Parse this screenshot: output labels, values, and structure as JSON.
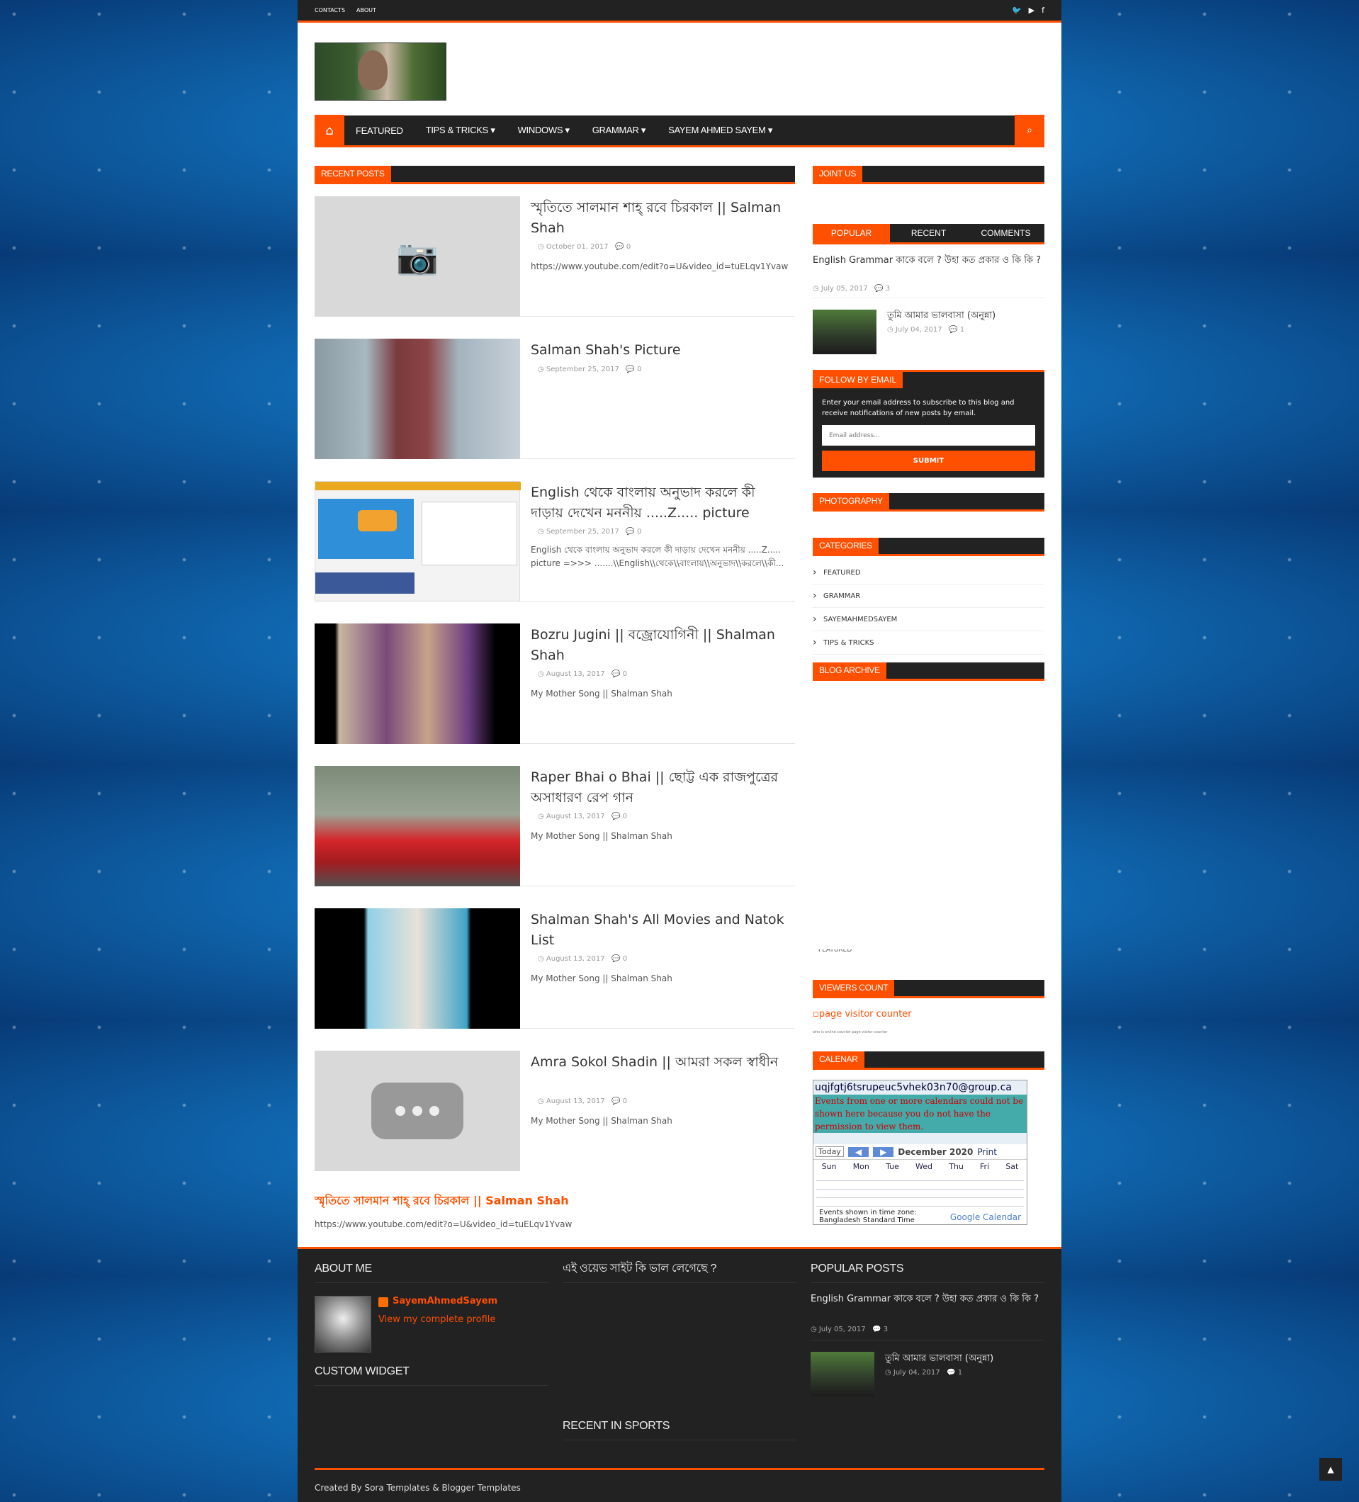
{
  "topbar": {
    "links": [
      "CONTACTS",
      "ABOUT"
    ],
    "social_icons": [
      "twitter-icon",
      "youtube-icon",
      "facebook-icon"
    ]
  },
  "nav": {
    "items": [
      "FEATURED",
      "TIPS & TRICKS",
      "WINDOWS",
      "GRAMMAR",
      "SAYEM AHMED SAYEM"
    ]
  },
  "recent_posts": {
    "heading": "RECENT POSTS",
    "posts": [
      {
        "title": "স্মৃতিতে সালমান শাহ্ রবে চিরকাল || Salman Shah",
        "date": "October 01, 2017",
        "comments": "0",
        "excerpt": "https://www.youtube.com/edit?o=U&video_id=tuELqv1Yvaw"
      },
      {
        "title": "Salman Shah's Picture",
        "date": "September 25, 2017",
        "comments": "0",
        "excerpt": ""
      },
      {
        "title": "English থেকে বাংলায় অনুভাদ করলে কী দাড়ায় দেখেন মননীয় .....Z..... picture",
        "date": "September 25, 2017",
        "comments": "0",
        "excerpt": "English থেকে বাংলায় অনুভাদ করলে কী দাড়ায় দেখেন মননীয় .....Z..... picture =>>> .......\\\\English\\\\থেকে\\\\বাংলায়\\\\অনুভাদ\\\\করলে\\\\কী..."
      },
      {
        "title": "Bozru Jugini || বজ্রোযোগিনী || Shalman Shah",
        "date": "August 13, 2017",
        "comments": "0",
        "excerpt": "My Mother Song || Shalman Shah"
      },
      {
        "title": "Raper Bhai o Bhai || ছোট্ট এক রাজপুত্রের অসাধারণ রেপ গান",
        "date": "August 13, 2017",
        "comments": "0",
        "excerpt": "My Mother Song || Shalman Shah"
      },
      {
        "title": "Shalman Shah's All Movies and Natok List",
        "date": "August 13, 2017",
        "comments": "0",
        "excerpt": "My Mother Song || Shalman Shah"
      },
      {
        "title": "Amra Sokol Shadin || আমরা সকল স্বাধীন",
        "date": "August 13, 2017",
        "comments": "0",
        "excerpt": "My Mother Song || Shalman Shah"
      }
    ]
  },
  "featured": {
    "title": "স্মৃতিতে সালমান শাহ্ রবে চিরকাল || Salman Shah",
    "url": "https://www.youtube.com/edit?o=U&video_id=tuELqv1Yvaw"
  },
  "sidebar": {
    "join_heading": "JOINT US",
    "tabs": [
      "POPULAR",
      "RECENT",
      "COMMENTS"
    ],
    "popular": [
      {
        "title": "English Grammar কাকে বলে ? উহা কত প্রকার ও কি কি ?",
        "date": "July 05, 2017",
        "comments": "3"
      },
      {
        "title": "তুমি আমার ভালবাসা (অনুন্না)",
        "date": "July 04, 2017",
        "comments": "1"
      }
    ],
    "follow": {
      "heading": "FOLLOW BY EMAIL",
      "text": "Enter your email address to subscribe to this blog and receive notifications of new posts by email.",
      "placeholder": "Email address...",
      "button": "SUBMIT"
    },
    "photography_heading": "PHOTOGRAPHY",
    "categories_heading": "CATEGORIES",
    "categories": [
      "FEATURED",
      "GRAMMAR",
      "SAYEMAHMEDSAYEM",
      "TIPS & TRICKS"
    ],
    "archive_heading": "BLOG ARCHIVE",
    "archive_fragment": "FEATURED",
    "viewers_heading": "VIEWERS COUNT",
    "viewers_alt": "page visitor counter",
    "viewers_small": "who is online counter page visitor counter",
    "calendar_heading": "CALENAR",
    "calendar": {
      "id": "uqjfgtj6tsrupeuc5vhek03n70@group.ca",
      "error": "Events from one or more calendars could not be shown here because you do not have the permission to view them.",
      "today": "Today",
      "month": "December 2020",
      "print": "Print",
      "days": [
        "Sun",
        "Mon",
        "Tue",
        "Wed",
        "Thu",
        "Fri",
        "Sat"
      ],
      "tz_label": "Events shown in time zone:",
      "tz": "Bangladesh Standard Time",
      "brand": "Google Calendar"
    }
  },
  "footer": {
    "about_heading": "ABOUT ME",
    "author": "SayemAhmedSayem",
    "profile_link": "View my complete profile",
    "custom_heading": "CUSTOM WIDGET",
    "poll_heading": "এই ওয়েভ সাইট কি ভাল লেগেছে ?",
    "sports_heading": "RECENT IN SPORTS",
    "popular_heading": "POPULAR POSTS",
    "popular": [
      {
        "title": "English Grammar কাকে বলে ? উহা কত প্রকার ও কি কি ?",
        "date": "July 05, 2017",
        "comments": "3"
      },
      {
        "title": "তুমি আমার ভালবাসা (অনুন্না)",
        "date": "July 04, 2017",
        "comments": "1"
      }
    ],
    "credit": "Created By Sora Templates & Blogger Templates"
  }
}
